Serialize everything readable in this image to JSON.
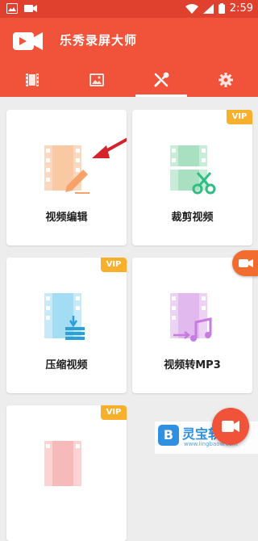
{
  "status_bar": {
    "time": "2:59"
  },
  "app": {
    "title": "乐秀录屏大师"
  },
  "tabs": [
    {
      "name": "videos",
      "icon": "film-icon"
    },
    {
      "name": "images",
      "icon": "image-icon"
    },
    {
      "name": "tools",
      "icon": "tools-icon",
      "active": true
    },
    {
      "name": "settings",
      "icon": "gear-icon"
    }
  ],
  "cards": [
    {
      "label": "视频编辑",
      "vip": false
    },
    {
      "label": "裁剪视频",
      "vip": true,
      "vip_label": "VIP"
    },
    {
      "label": "压缩视频",
      "vip": true,
      "vip_label": "VIP"
    },
    {
      "label": "视频转MP3",
      "vip": false
    },
    {
      "label": "",
      "vip": true,
      "vip_label": "VIP"
    }
  ],
  "watermark": {
    "text": "灵宝软件",
    "url": "www.lingbaow.com",
    "logo_letter": "B"
  },
  "colors": {
    "primary": "#f0533a",
    "vip": "#f6b02b",
    "arrow": "#d4232b"
  }
}
